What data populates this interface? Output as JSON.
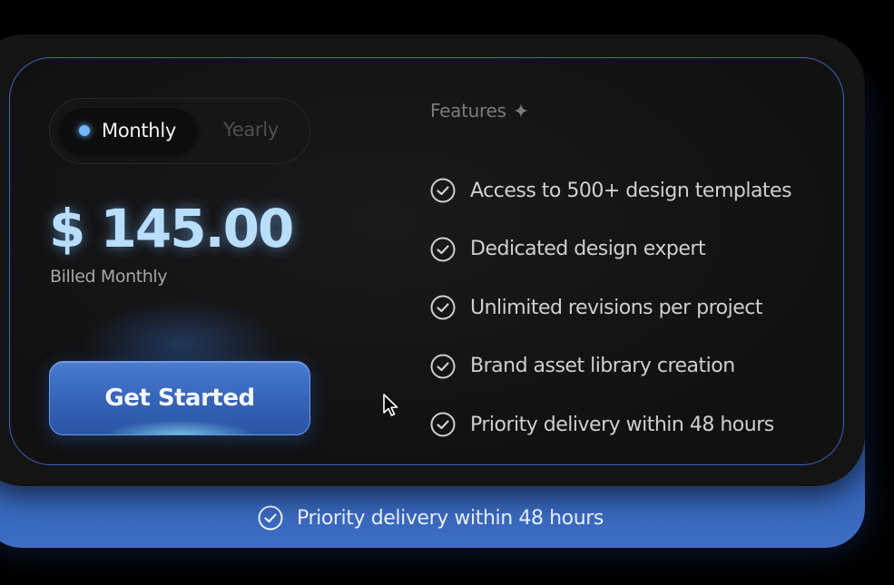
{
  "pricing": {
    "toggle": {
      "options": [
        "Monthly",
        "Yearly"
      ],
      "active": "Monthly"
    },
    "price": "$ 145.00",
    "billing_note": "Billed Monthly",
    "cta_label": "Get Started"
  },
  "features": {
    "title": "Features",
    "title_icon": "sparkle-icon",
    "items": [
      "Access to 500+ design templates",
      "Dedicated design expert",
      "Unlimited revisions per project",
      "Brand asset library creation",
      "Priority delivery within 48 hours"
    ],
    "item_icon": "check-circle-icon"
  },
  "tray": {
    "feature": "Priority delivery within 48 hours",
    "icon": "check-circle-icon"
  },
  "colors": {
    "background": "#000000",
    "card": "#141414",
    "card_border": "#3a63b8",
    "accent": "#4a7cd3",
    "price": "#b8defb",
    "toggle_dot": "#6fb7ff"
  }
}
